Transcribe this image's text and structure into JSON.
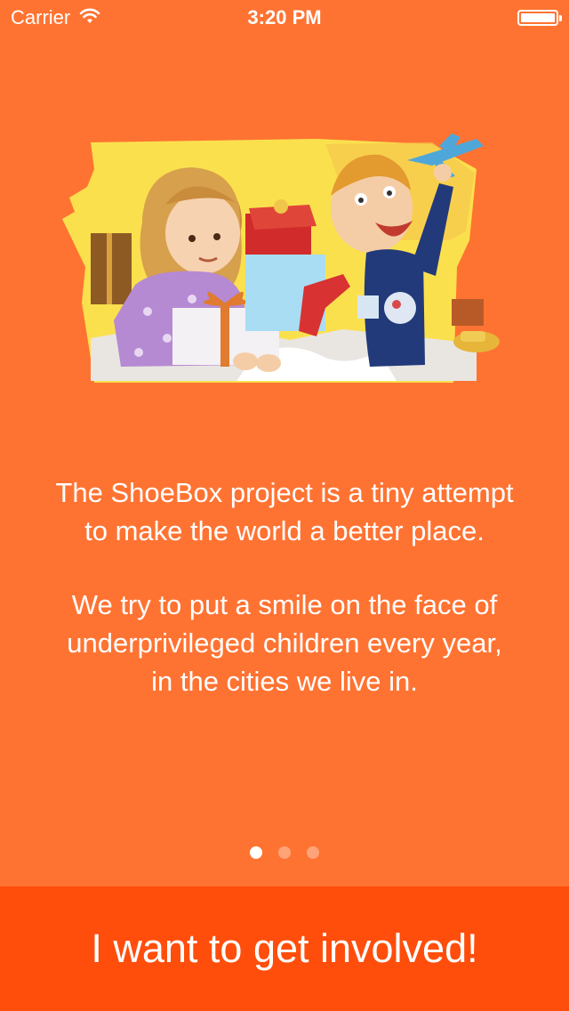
{
  "status_bar": {
    "carrier": "Carrier",
    "time": "3:20 PM",
    "wifi_icon": "wifi-icon",
    "battery_icon": "battery-icon"
  },
  "onboarding": {
    "illustration": "children-opening-gifts-illustration",
    "paragraphs": [
      "The ShoeBox project is a tiny attempt to make the world a better place.",
      "We try to put a smile on the face of underprivileged children every year, in the cities we live in."
    ],
    "page_indicator": {
      "total": 3,
      "current": 1
    }
  },
  "cta": {
    "label": "I want to get involved!"
  },
  "colors": {
    "background": "#FF7332",
    "cta_background": "#FF4E0C",
    "text": "#FFFFFF"
  }
}
